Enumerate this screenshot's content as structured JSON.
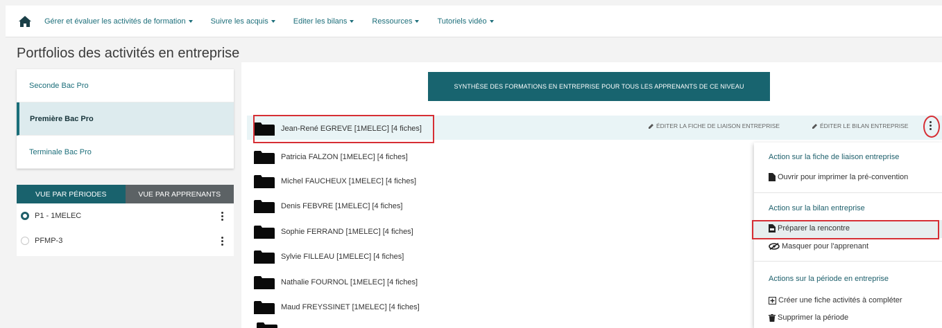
{
  "nav": {
    "home_icon": "home-icon",
    "items": [
      {
        "label": "Gérer et évaluer les activités de formation"
      },
      {
        "label": "Suivre les acquis"
      },
      {
        "label": "Editer les bilans"
      },
      {
        "label": "Ressources"
      },
      {
        "label": "Tutoriels vidéo"
      }
    ]
  },
  "page": {
    "title": "Portfolios des activités en entreprise"
  },
  "levels": [
    {
      "label": "Seconde Bac Pro"
    },
    {
      "label": "Première Bac Pro"
    },
    {
      "label": "Terminale Bac Pro"
    }
  ],
  "view_tabs": {
    "periods": "VUE PAR PÉRIODES",
    "learners": "VUE PAR APPRENANTS"
  },
  "periods": [
    {
      "label": "P1 - 1MELEC",
      "checked": true
    },
    {
      "label": "PFMP-3",
      "checked": false
    }
  ],
  "synthesis_button": "SYNTHÈSE DES FORMATIONS EN ENTREPRISE POUR TOUS LES APPRENANTS DE CE NIVEAU",
  "row_actions": {
    "edit_liaison": "ÉDITER LA FICHE DE LIAISON ENTREPRISE",
    "edit_bilan": "ÉDITER LE BILAN ENTREPRISE"
  },
  "learners": [
    {
      "label": "Jean-René EGREVE [1MELEC] [4 fiches]"
    },
    {
      "label": "Patricia FALZON [1MELEC] [4 fiches]"
    },
    {
      "label": "Michel FAUCHEUX [1MELEC] [4 fiches]"
    },
    {
      "label": "Denis FEBVRE [1MELEC] [4 fiches]"
    },
    {
      "label": "Sophie FERRAND [1MELEC] [4 fiches]"
    },
    {
      "label": "Sylvie FILLEAU [1MELEC] [4 fiches]"
    },
    {
      "label": "Nathalie FOURNOL [1MELEC] [4 fiches]"
    },
    {
      "label": "Maud FREYSSINET [1MELEC] [4 fiches]"
    }
  ],
  "dropdown": {
    "header_liaison": "Action sur la fiche de liaison entreprise",
    "open_print": "Ouvrir pour imprimer la pré-convention",
    "header_bilan": "Action sur la bilan entreprise",
    "prepare": "Préparer la rencontre",
    "hide": "Masquer pour l'apprenant",
    "header_periode": "Actions sur la période en entreprise",
    "create": "Créer une fiche activités à compléter",
    "delete": "Supprimer la période"
  },
  "colors": {
    "accent": "#18646f",
    "highlight": "#d62e34",
    "link": "#1c6e7a"
  }
}
